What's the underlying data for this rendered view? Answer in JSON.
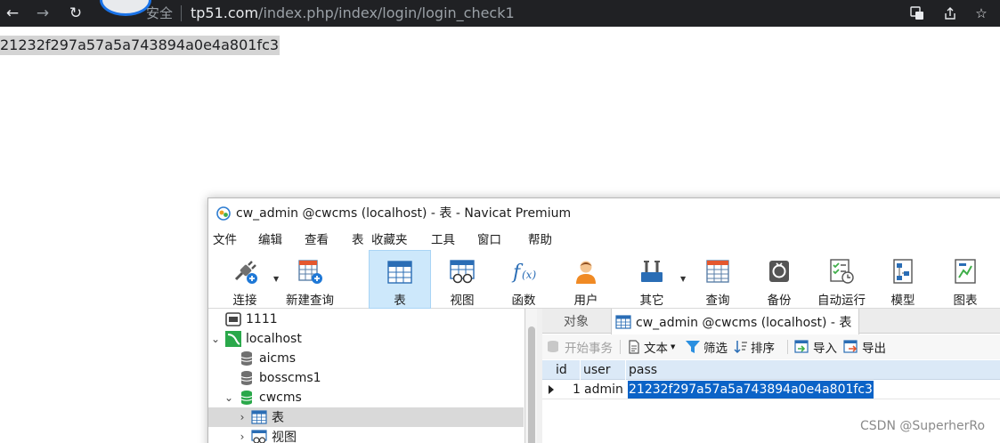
{
  "browser": {
    "secure_label": "安全",
    "url_host": "tp51.com",
    "url_path": "/index.php/index/login/login_check1"
  },
  "page": {
    "output_text": "21232f297a57a5a743894a0e4a801fc3"
  },
  "navicat": {
    "title": "cw_admin @cwcms (localhost) - 表 - Navicat Premium",
    "menu": [
      "文件",
      "编辑",
      "查看",
      "表",
      "收藏夹",
      "工具",
      "窗口",
      "帮助"
    ],
    "toolbar": {
      "connect": "连接",
      "new_query": "新建查询",
      "table": "表",
      "view": "视图",
      "function": "函数",
      "user": "用户",
      "other": "其它",
      "query": "查询",
      "backup": "备份",
      "automation": "自动运行",
      "model": "模型",
      "chart": "图表"
    },
    "tree": [
      {
        "label": "1111"
      },
      {
        "label": "localhost"
      },
      {
        "label": "aicms"
      },
      {
        "label": "bosscms1"
      },
      {
        "label": "cwcms"
      },
      {
        "label": "表"
      },
      {
        "label": "视图"
      }
    ],
    "tabs": {
      "objects": "对象",
      "active": "cw_admin @cwcms (localhost) - 表"
    },
    "sub_toolbar": {
      "begin_transaction": "开始事务",
      "text": "文本",
      "filter": "筛选",
      "sort": "排序",
      "import": "导入",
      "export": "导出"
    },
    "grid": {
      "columns": [
        "id",
        "user",
        "pass"
      ],
      "rows": [
        {
          "id": "1",
          "user": "admin",
          "pass": "21232f297a57a5a743894a0e4a801fc3"
        }
      ]
    }
  },
  "watermark": "CSDN @SuperherRo",
  "colors": {
    "browser_bar": "#202124",
    "toolbar_active": "#cde8fb",
    "selection": "#0b63c7",
    "grid_header": "#dbe9f7"
  }
}
